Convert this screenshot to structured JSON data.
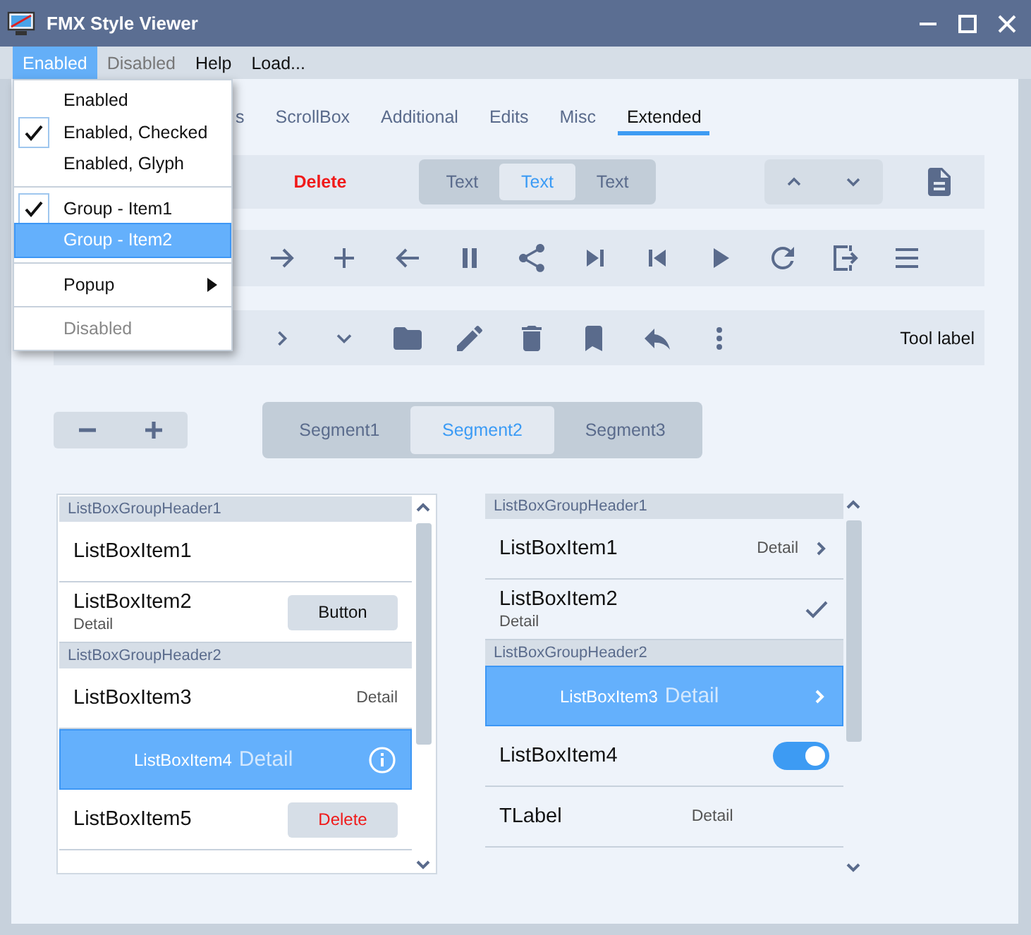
{
  "window": {
    "title": "FMX Style Viewer"
  },
  "menu_bar": [
    {
      "label": "Enabled",
      "selected": true,
      "disabled": false
    },
    {
      "label": "Disabled",
      "selected": false,
      "disabled": true
    },
    {
      "label": "Help",
      "selected": false,
      "disabled": false
    },
    {
      "label": "Load...",
      "selected": false,
      "disabled": false
    }
  ],
  "menu": [
    {
      "kind": "item",
      "label": "Enabled",
      "checked": false,
      "selected": false,
      "disabled": false
    },
    {
      "kind": "item",
      "label": "Enabled, Checked",
      "checked": true,
      "selected": false,
      "disabled": false
    },
    {
      "kind": "item",
      "label": "Enabled, Glyph",
      "checked": false,
      "selected": false,
      "disabled": false
    },
    {
      "kind": "separator"
    },
    {
      "kind": "item",
      "label": "Group - Item1",
      "checked": true,
      "selected": false,
      "disabled": false
    },
    {
      "kind": "item",
      "label": "Group - Item2",
      "checked": false,
      "selected": true,
      "disabled": false
    },
    {
      "kind": "separator"
    },
    {
      "kind": "submenu",
      "label": "Popup",
      "checked": false,
      "selected": false,
      "disabled": false
    },
    {
      "kind": "separator"
    },
    {
      "kind": "item",
      "label": "Disabled",
      "checked": false,
      "selected": false,
      "disabled": true
    }
  ],
  "tabs": [
    {
      "label": "s",
      "selected": false
    },
    {
      "label": "ScrollBox",
      "selected": false
    },
    {
      "label": "Additional",
      "selected": false
    },
    {
      "label": "Edits",
      "selected": false
    },
    {
      "label": "Misc",
      "selected": false
    },
    {
      "label": "Extended",
      "selected": true
    }
  ],
  "toolbar_1": {
    "delete_button": "Delete",
    "text_segments": [
      {
        "label": "Text",
        "selected": false
      },
      {
        "label": "Text",
        "selected": true
      },
      {
        "label": "Text",
        "selected": false
      }
    ]
  },
  "toolbar_3": {
    "tool_label": "Tool label"
  },
  "segments": [
    {
      "label": "Segment1",
      "selected": false
    },
    {
      "label": "Segment2",
      "selected": true
    },
    {
      "label": "Segment3",
      "selected": false
    }
  ],
  "list_left": [
    {
      "kind": "header",
      "label": "ListBoxGroupHeader1"
    },
    {
      "kind": "plain",
      "label": "ListBoxItem1",
      "selected": false
    },
    {
      "kind": "subtitle",
      "label": "ListBoxItem2",
      "detail": "Detail",
      "selected": false,
      "button": {
        "label": "Button",
        "danger": false
      }
    },
    {
      "kind": "header",
      "label": "ListBoxGroupHeader2"
    },
    {
      "kind": "right-detail",
      "label": "ListBoxItem3",
      "detail": "Detail",
      "selected": false
    },
    {
      "kind": "right-detail",
      "label": "ListBoxItem4",
      "detail": "Detail",
      "selected": true,
      "accessory": {
        "kind": "info"
      }
    },
    {
      "kind": "plain",
      "label": "ListBoxItem5",
      "selected": false,
      "button": {
        "label": "Delete",
        "danger": true
      }
    }
  ],
  "list_right": [
    {
      "kind": "header",
      "label": "ListBoxGroupHeader1"
    },
    {
      "kind": "right-detail",
      "label": "ListBoxItem1",
      "detail": "Detail",
      "selected": false,
      "accessory": {
        "kind": "chevron"
      }
    },
    {
      "kind": "subtitle",
      "label": "ListBoxItem2",
      "detail": "Detail",
      "selected": false,
      "accessory": {
        "kind": "check"
      }
    },
    {
      "kind": "header",
      "label": "ListBoxGroupHeader2"
    },
    {
      "kind": "right-detail",
      "label": "ListBoxItem3",
      "detail": "Detail",
      "selected": true,
      "accessory": {
        "kind": "chevron"
      }
    },
    {
      "kind": "toggle",
      "label": "ListBoxItem4",
      "selected": false,
      "on": true
    },
    {
      "kind": "label-detail",
      "label": "TLabel",
      "detail": "Detail",
      "selected": false
    }
  ]
}
